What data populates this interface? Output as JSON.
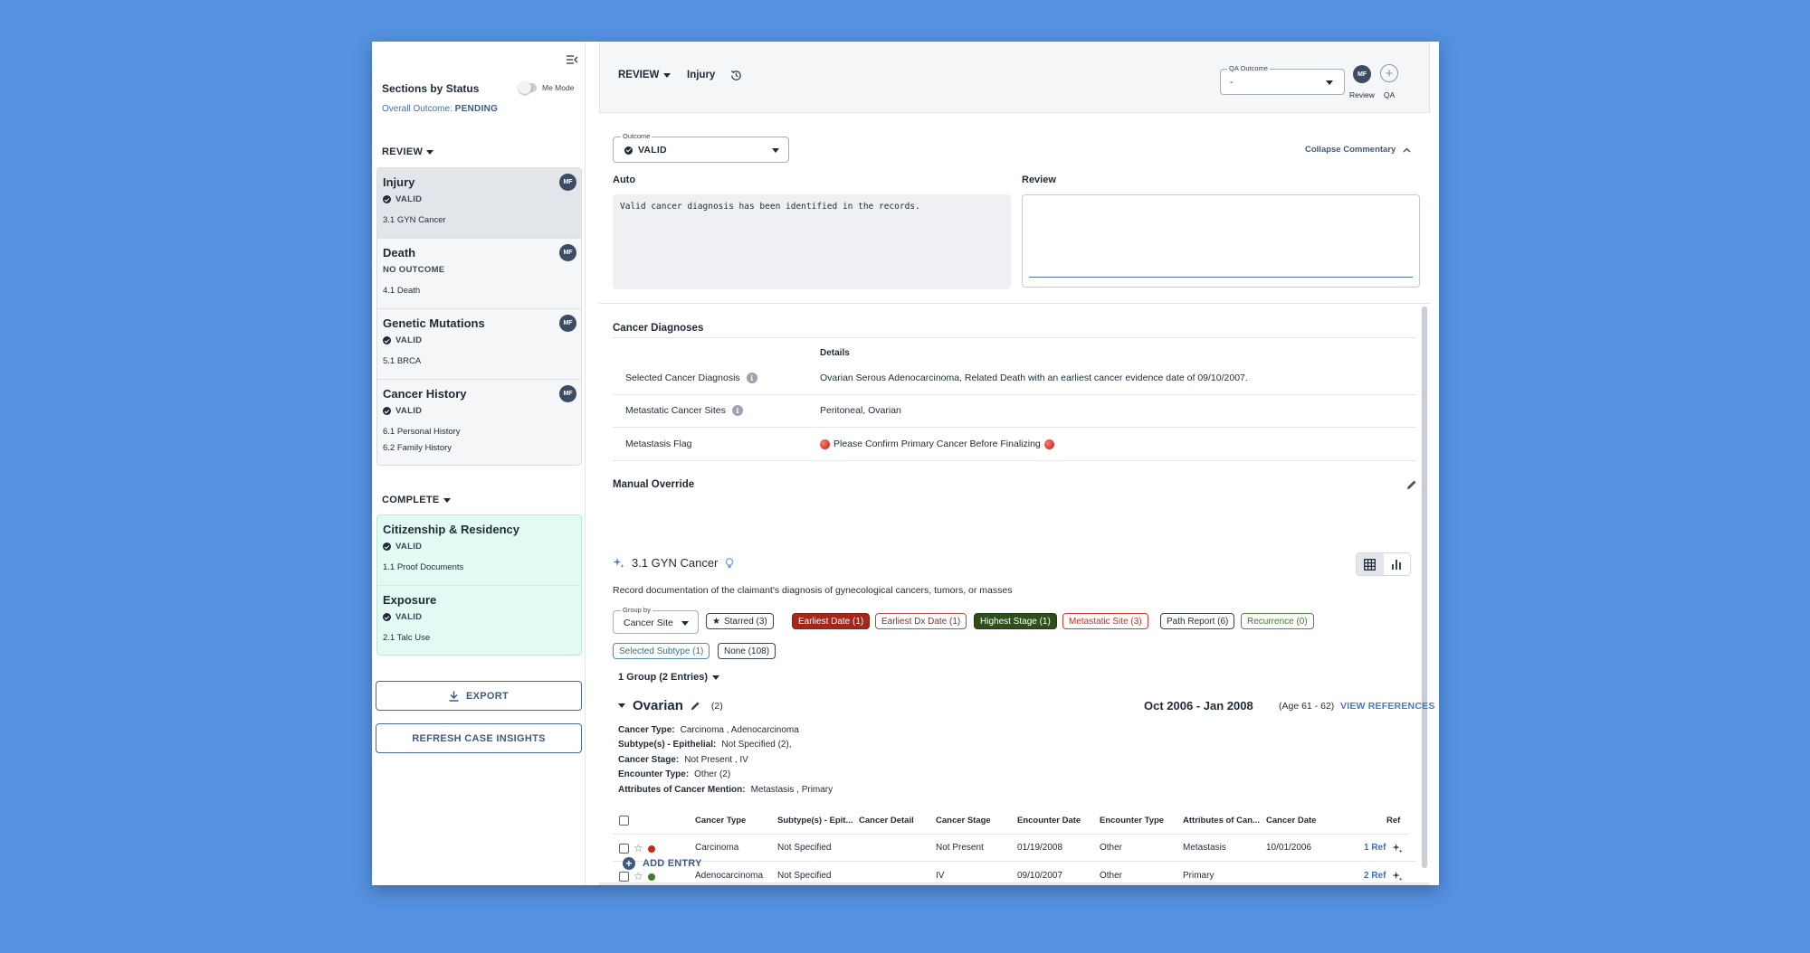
{
  "sidebar": {
    "title": "Sections by Status",
    "me_mode_label": "Me Mode",
    "overall_label": "Overall Outcome:",
    "overall_value": "PENDING",
    "review_group": "REVIEW",
    "review_items": [
      {
        "title": "Injury",
        "status": "VALID",
        "sub": [
          "3.1 GYN Cancer"
        ],
        "avatar": "MF"
      },
      {
        "title": "Death",
        "status": "NO OUTCOME",
        "sub": [
          "4.1 Death"
        ],
        "avatar": "MF"
      },
      {
        "title": "Genetic Mutations",
        "status": "VALID",
        "sub": [
          "5.1 BRCA"
        ],
        "avatar": "MF"
      },
      {
        "title": "Cancer History",
        "status": "VALID",
        "sub": [
          "6.1 Personal History",
          "6.2 Family History"
        ],
        "avatar": "MF"
      }
    ],
    "complete_group": "COMPLETE",
    "complete_items": [
      {
        "title": "Citizenship & Residency",
        "status": "VALID",
        "sub": [
          "1.1 Proof Documents"
        ]
      },
      {
        "title": "Exposure",
        "status": "VALID",
        "sub": [
          "2.1 Talc Use"
        ]
      }
    ],
    "export_label": "EXPORT",
    "refresh_label": "REFRESH CASE INSIGHTS"
  },
  "topbar": {
    "review_dropdown": "REVIEW",
    "section": "Injury",
    "qa_label": "QA Outcome",
    "qa_value": "-",
    "avatar": "MF",
    "review_label": "Review",
    "qa_short": "QA"
  },
  "outcome": {
    "label": "Outcome",
    "value": "VALID",
    "collapse_label": "Collapse Commentary"
  },
  "commentary": {
    "auto_label": "Auto",
    "auto_text": "Valid cancer diagnosis has been identified in the records.",
    "review_label": "Review"
  },
  "diagnoses": {
    "title": "Cancer Diagnoses",
    "details_header": "Details",
    "rows": [
      {
        "label": "Selected Cancer Diagnosis",
        "value": "Ovarian Serous Adenocarcinoma, Related Death with an earliest cancer evidence date of 09/10/2007."
      },
      {
        "label": "Metastatic Cancer Sites",
        "value": "Peritoneal, Ovarian"
      },
      {
        "label": "Metastasis Flag",
        "value": "Please Confirm Primary Cancer Before Finalizing"
      }
    ]
  },
  "override": {
    "title": "Manual Override"
  },
  "gyn": {
    "title": "3.1 GYN Cancer",
    "description": "Record documentation of the claimant's diagnosis of gynecological cancers, tumors, or masses",
    "groupby_label": "Group by",
    "groupby_value": "Cancer Site",
    "chips": {
      "starred": "Starred (3)",
      "earliest": "Earliest Date (1)",
      "earliest_dx": "Earliest Dx Date (1)",
      "highest": "Highest Stage (1)",
      "metastatic": "Metastatic Site (3)",
      "path": "Path Report (6)",
      "recurrence": "Recurrence (0)",
      "subtype": "Selected Subtype (1)",
      "none": "None (108)"
    },
    "groups_label": "1 Group (2 Entries)"
  },
  "ovarian": {
    "title": "Ovarian",
    "count": "(2)",
    "range": "Oct 2006 - Jan 2008",
    "age": "(Age 61 - 62)",
    "refs": "VIEW REFERENCES",
    "attrs": [
      {
        "k": "Cancer Type:",
        "v": "Carcinoma ,  Adenocarcinoma"
      },
      {
        "k": "Subtype(s) - Epithelial:",
        "v": "Not Specified (2),"
      },
      {
        "k": "Cancer Stage:",
        "v": "Not Present ,  IV"
      },
      {
        "k": "Encounter Type:",
        "v": "Other (2)"
      },
      {
        "k": "Attributes of Cancer Mention:",
        "v": "Metastasis ,  Primary"
      }
    ]
  },
  "table": {
    "headers": [
      "Cancer Type",
      "Subtype(s) - Epit...",
      "Cancer Detail",
      "Cancer Stage",
      "Encounter Date",
      "Encounter Type",
      "Attributes of Can...",
      "Cancer Date",
      "Ref"
    ],
    "rows": [
      {
        "type": "Carcinoma",
        "subtype": "Not Specified",
        "detail": "",
        "stage": "Not Present",
        "enc_date": "01/19/2008",
        "enc_type": "Other",
        "attr": "Metastasis",
        "date": "10/01/2006",
        "ref": "1 Ref",
        "dot": "#c62a1d"
      },
      {
        "type": "Adenocarcinoma",
        "subtype": "Not Specified",
        "detail": "",
        "stage": "IV",
        "enc_date": "09/10/2007",
        "enc_type": "Other",
        "attr": "Primary",
        "date": "",
        "ref": "2 Ref",
        "dot": "#3f7a2d"
      }
    ],
    "add_entry": "ADD ENTRY"
  }
}
